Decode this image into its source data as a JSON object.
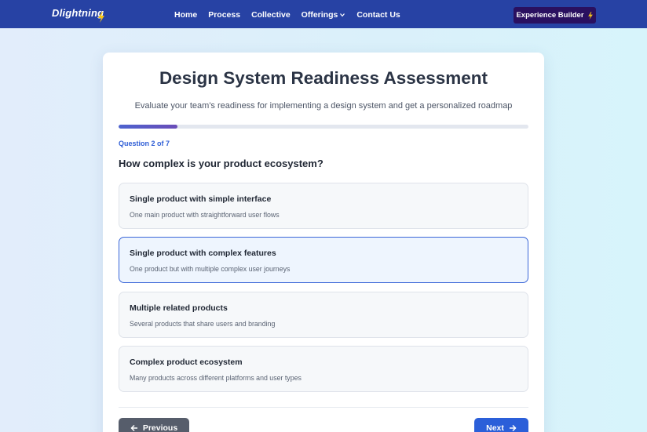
{
  "nav": {
    "logo": "Dlightning",
    "links": [
      "Home",
      "Process",
      "Collective",
      "Offerings",
      "Contact Us"
    ],
    "cta_label": "Experience Builder"
  },
  "assessment": {
    "title": "Design System Readiness Assessment",
    "subtitle": "Evaluate your team's readiness for implementing a design system and get a personalized roadmap",
    "progress": 0.143,
    "question_counter": "Question 2 of 7",
    "question": "How complex is your product ecosystem?",
    "options": [
      {
        "title": "Single product with simple interface",
        "desc": "One main product with straightforward user flows",
        "selected": false
      },
      {
        "title": "Single product with complex features",
        "desc": "One product but with multiple complex user journeys",
        "selected": true
      },
      {
        "title": "Multiple related products",
        "desc": "Several products that share users and branding",
        "selected": false
      },
      {
        "title": "Complex product ecosystem",
        "desc": "Many products across different platforms and user types",
        "selected": false
      }
    ],
    "prev_label": "Previous",
    "next_label": "Next"
  },
  "colors": {
    "nav_bg": "#2742a4",
    "cta_bg": "#2a1060",
    "accent": "#2b5fd9",
    "bolt": "#f5c518"
  },
  "icons": [
    "lightning-icon",
    "chevron-down-icon",
    "arrow-left-icon",
    "arrow-right-icon"
  ]
}
